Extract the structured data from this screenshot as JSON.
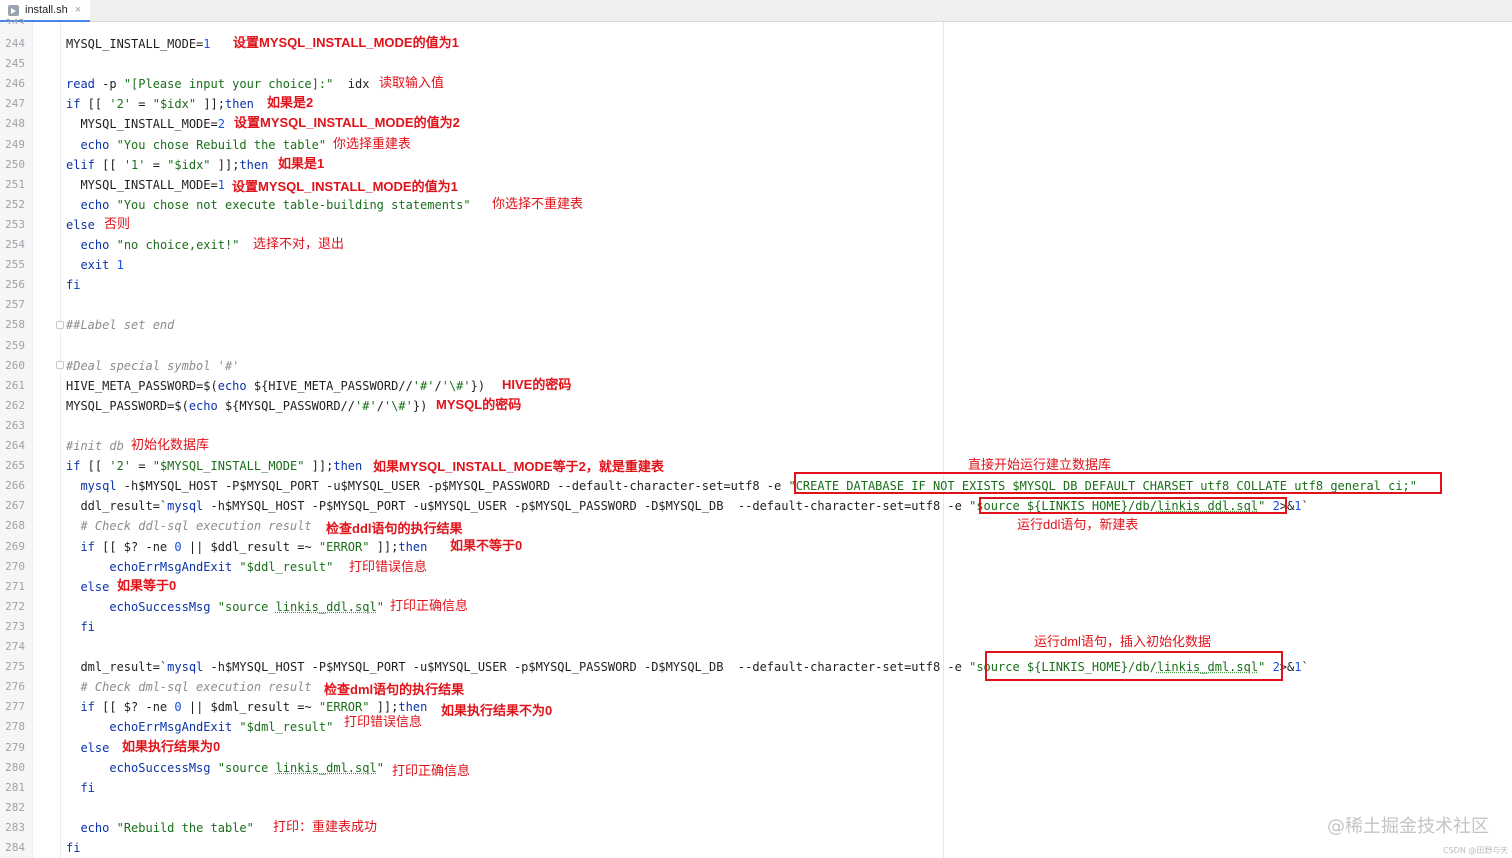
{
  "tab": {
    "filename": "install.sh",
    "close_glyph": "×"
  },
  "top_partial_line_number": "243",
  "lines": [
    {
      "n": "244",
      "code": "MYSQL_INSTALL_MODE=1",
      "note": "设置MYSQL_INSTALL_MODE的值为1"
    },
    {
      "n": "245",
      "code": ""
    },
    {
      "n": "246",
      "code": "read -p \"[Please input your choice]:\"  idx",
      "note": "读取输入值"
    },
    {
      "n": "247",
      "code": "if [[ '2' = \"$idx\" ]];then",
      "note": "如果是2"
    },
    {
      "n": "248",
      "code": "  MYSQL_INSTALL_MODE=2",
      "note": "设置MYSQL_INSTALL_MODE的值为2"
    },
    {
      "n": "249",
      "code": "  echo \"You chose Rebuild the table\"",
      "note": "你选择重建表"
    },
    {
      "n": "250",
      "code": "elif [[ '1' = \"$idx\" ]];then",
      "note": "如果是1"
    },
    {
      "n": "251",
      "code": "  MYSQL_INSTALL_MODE=1",
      "note": "设置MYSQL_INSTALL_MODE的值为1"
    },
    {
      "n": "252",
      "code": "  echo \"You chose not execute table-building statements\"",
      "note": "你选择不重建表"
    },
    {
      "n": "253",
      "code": "else",
      "note": "否则"
    },
    {
      "n": "254",
      "code": "  echo \"no choice,exit!\"",
      "note": "选择不对，退出"
    },
    {
      "n": "255",
      "code": "  exit 1"
    },
    {
      "n": "256",
      "code": "fi"
    },
    {
      "n": "257",
      "code": ""
    },
    {
      "n": "258",
      "code": "##Label set end"
    },
    {
      "n": "259",
      "code": ""
    },
    {
      "n": "260",
      "code": "#Deal special symbol '#'"
    },
    {
      "n": "261",
      "code": "HIVE_META_PASSWORD=$(echo ${HIVE_META_PASSWORD//'#'/'\\#'})",
      "note": "HIVE的密码"
    },
    {
      "n": "262",
      "code": "MYSQL_PASSWORD=$(echo ${MYSQL_PASSWORD//'#'/'\\#'})",
      "note": "MYSQL的密码"
    },
    {
      "n": "263",
      "code": ""
    },
    {
      "n": "264",
      "code": "#init db",
      "note": "初始化数据库"
    },
    {
      "n": "265",
      "code": "if [[ '2' = \"$MYSQL_INSTALL_MODE\" ]];then",
      "note": "如果MYSQL_INSTALL_MODE等于2，就是重建表"
    },
    {
      "n": "266",
      "code": "  mysql -h$MYSQL_HOST -P$MYSQL_PORT -u$MYSQL_USER -p$MYSQL_PASSWORD --default-character-set=utf8 -e \"CREATE DATABASE IF NOT EXISTS $MYSQL_DB DEFAULT CHARSET utf8 COLLATE utf8_general_ci;\""
    },
    {
      "n": "267",
      "code": "  ddl_result=`mysql -h$MYSQL_HOST -P$MYSQL_PORT -u$MYSQL_USER -p$MYSQL_PASSWORD -D$MYSQL_DB  --default-character-set=utf8 -e \"source ${LINKIS_HOME}/db/linkis_ddl.sql\" 2>&1`"
    },
    {
      "n": "268",
      "code": "  # Check ddl-sql execution result",
      "note": "检查ddl语句的执行结果"
    },
    {
      "n": "269",
      "code": "  if [[ $? -ne 0 || $ddl_result =~ \"ERROR\" ]];then",
      "note": "如果不等于0"
    },
    {
      "n": "270",
      "code": "      echoErrMsgAndExit \"$ddl_result\"",
      "note": "打印错误信息"
    },
    {
      "n": "271",
      "code": "  else",
      "note": "如果等于0"
    },
    {
      "n": "272",
      "code": "      echoSuccessMsg \"source linkis_ddl.sql\"",
      "note": "打印正确信息"
    },
    {
      "n": "273",
      "code": "  fi"
    },
    {
      "n": "274",
      "code": ""
    },
    {
      "n": "275",
      "code": "  dml_result=`mysql -h$MYSQL_HOST -P$MYSQL_PORT -u$MYSQL_USER -p$MYSQL_PASSWORD -D$MYSQL_DB  --default-character-set=utf8 -e \"source ${LINKIS_HOME}/db/linkis_dml.sql\" 2>&1`"
    },
    {
      "n": "276",
      "code": "  # Check dml-sql execution result",
      "note": "检查dml语句的执行结果"
    },
    {
      "n": "277",
      "code": "  if [[ $? -ne 0 || $dml_result =~ \"ERROR\" ]];then",
      "note": "如果执行结果不为0"
    },
    {
      "n": "278",
      "code": "      echoErrMsgAndExit \"$dml_result\"",
      "note": "打印错误信息"
    },
    {
      "n": "279",
      "code": "  else",
      "note": "如果执行结果为0"
    },
    {
      "n": "280",
      "code": "      echoSuccessMsg \"source linkis_dml.sql\"",
      "note": "打印正确信息"
    },
    {
      "n": "281",
      "code": "  fi"
    },
    {
      "n": "282",
      "code": ""
    },
    {
      "n": "283",
      "code": "  echo \"Rebuild the table\"",
      "note": "打印：重建表成功"
    },
    {
      "n": "284",
      "code": "fi"
    }
  ],
  "callouts": {
    "create_db": "直接开始运行建立数据库",
    "ddl": "运行ddl语句，新建表",
    "dml": "运行dml语句，插入初始化数据"
  },
  "watermark": {
    "main": "@稀土掘金技术社区",
    "small": "CSDN @田野与天"
  },
  "colors": {
    "annotation": "#e0121a",
    "keyword": "#0b33a8",
    "string": "#1a6e1a",
    "comment": "#8c8c8c"
  }
}
